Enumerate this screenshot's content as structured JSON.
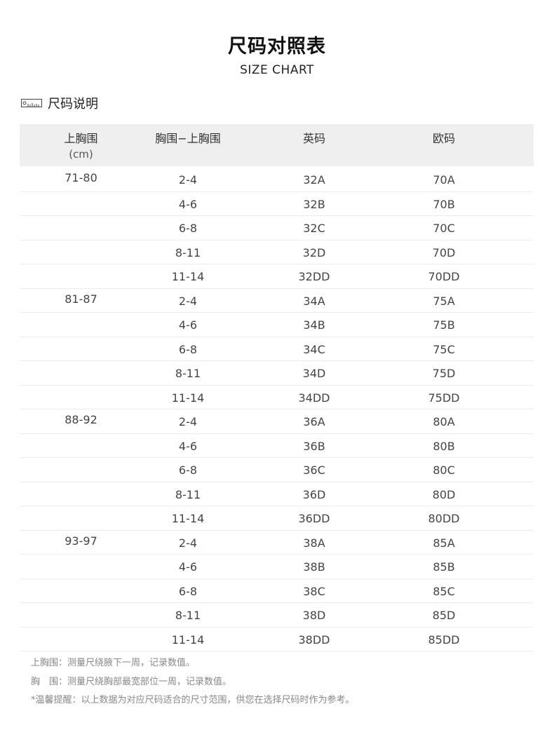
{
  "header": {
    "title": "尺码对照表",
    "subtitle": "SIZE CHART"
  },
  "section": {
    "icon": "ruler-icon",
    "label": "尺码说明"
  },
  "table": {
    "headers": {
      "bust": "上胸围",
      "bust_unit": "(cm)",
      "diff": "胸围−上胸围",
      "uk": "英码",
      "eu": "欧码"
    },
    "rows": [
      {
        "bust": "71-80",
        "diff": "2-4",
        "uk": "32A",
        "eu": "70A"
      },
      {
        "bust": "",
        "diff": "4-6",
        "uk": "32B",
        "eu": "70B"
      },
      {
        "bust": "",
        "diff": "6-8",
        "uk": "32C",
        "eu": "70C"
      },
      {
        "bust": "",
        "diff": "8-11",
        "uk": "32D",
        "eu": "70D"
      },
      {
        "bust": "",
        "diff": "11-14",
        "uk": "32DD",
        "eu": "70DD"
      },
      {
        "bust": "81-87",
        "diff": "2-4",
        "uk": "34A",
        "eu": "75A"
      },
      {
        "bust": "",
        "diff": "4-6",
        "uk": "34B",
        "eu": "75B"
      },
      {
        "bust": "",
        "diff": "6-8",
        "uk": "34C",
        "eu": "75C"
      },
      {
        "bust": "",
        "diff": "8-11",
        "uk": "34D",
        "eu": "75D"
      },
      {
        "bust": "",
        "diff": "11-14",
        "uk": "34DD",
        "eu": "75DD"
      },
      {
        "bust": "88-92",
        "diff": "2-4",
        "uk": "36A",
        "eu": "80A"
      },
      {
        "bust": "",
        "diff": "4-6",
        "uk": "36B",
        "eu": "80B"
      },
      {
        "bust": "",
        "diff": "6-8",
        "uk": "36C",
        "eu": "80C"
      },
      {
        "bust": "",
        "diff": "8-11",
        "uk": "36D",
        "eu": "80D"
      },
      {
        "bust": "",
        "diff": "11-14",
        "uk": "36DD",
        "eu": "80DD"
      },
      {
        "bust": "93-97",
        "diff": "2-4",
        "uk": "38A",
        "eu": "85A"
      },
      {
        "bust": "",
        "diff": "4-6",
        "uk": "38B",
        "eu": "85B"
      },
      {
        "bust": "",
        "diff": "6-8",
        "uk": "38C",
        "eu": "85C"
      },
      {
        "bust": "",
        "diff": "8-11",
        "uk": "38D",
        "eu": "85D"
      },
      {
        "bust": "",
        "diff": "11-14",
        "uk": "38DD",
        "eu": "85DD"
      }
    ]
  },
  "notes": [
    "上胸围：测量尺绕腋下一周，记录数值。",
    "胸　围：测量尺绕胸部最宽部位一周，记录数值。",
    "*温馨提醒：以上数据为对应尺码适合的尺寸范围，供您在选择尺码时作为参考。"
  ]
}
